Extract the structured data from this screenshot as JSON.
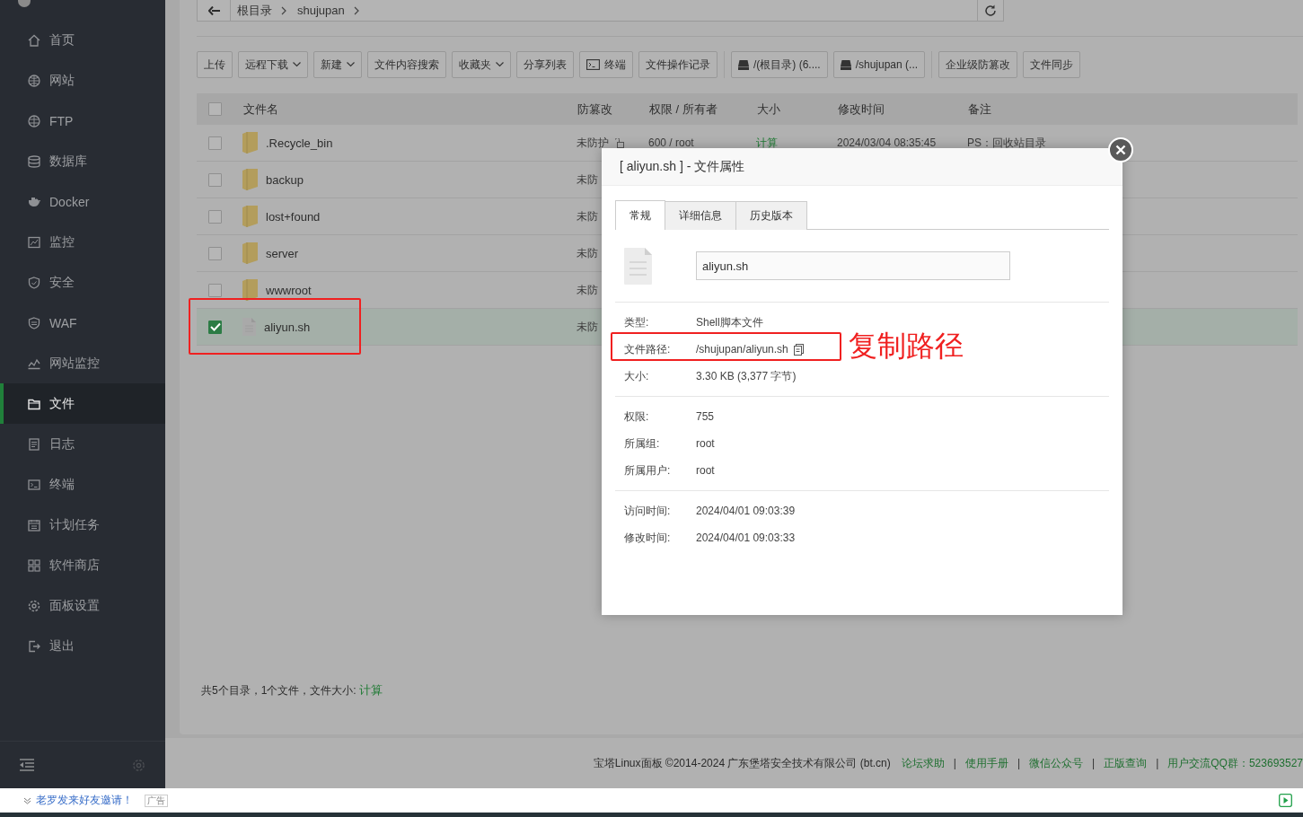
{
  "sidebar": {
    "items": [
      {
        "label": "首页",
        "selected": false
      },
      {
        "label": "网站",
        "selected": false
      },
      {
        "label": "FTP",
        "selected": false
      },
      {
        "label": "数据库",
        "selected": false
      },
      {
        "label": "Docker",
        "selected": false
      },
      {
        "label": "监控",
        "selected": false
      },
      {
        "label": "安全",
        "selected": false
      },
      {
        "label": "WAF",
        "selected": false
      },
      {
        "label": "网站监控",
        "selected": false
      },
      {
        "label": "文件",
        "selected": true
      },
      {
        "label": "日志",
        "selected": false
      },
      {
        "label": "终端",
        "selected": false
      },
      {
        "label": "计划任务",
        "selected": false
      },
      {
        "label": "软件商店",
        "selected": false
      },
      {
        "label": "面板设置",
        "selected": false
      },
      {
        "label": "退出",
        "selected": false
      }
    ]
  },
  "breadcrumb": {
    "crumbs": [
      "根目录",
      "shujupan"
    ]
  },
  "toolbar": [
    {
      "label": "上传",
      "kind": "button"
    },
    {
      "label": "远程下载",
      "kind": "dropdown"
    },
    {
      "label": "新建",
      "kind": "dropdown"
    },
    {
      "label": "文件内容搜索",
      "kind": "button"
    },
    {
      "label": "收藏夹",
      "kind": "dropdown"
    },
    {
      "label": "分享列表",
      "kind": "button"
    },
    {
      "label": "终端",
      "kind": "terminal"
    },
    {
      "label": "文件操作记录",
      "kind": "button"
    },
    {
      "label": "/(根目录) (6....",
      "kind": "disk"
    },
    {
      "label": "/shujupan (...",
      "kind": "disk"
    },
    {
      "label": "企业级防篡改",
      "kind": "button"
    },
    {
      "label": "文件同步",
      "kind": "button"
    }
  ],
  "table": {
    "all_checked": false,
    "columns": [
      "文件名",
      "防篡改",
      "权限 / 所有者",
      "大小",
      "修改时间",
      "备注"
    ],
    "rows": [
      {
        "name": ".Recycle_bin",
        "kind": "folder",
        "checked": false,
        "selected": false,
        "protection": "未防护",
        "permission": "600 / root",
        "size": "计算",
        "modified": "2024/03/04 08:35:45",
        "note": "PS：回收站目录"
      },
      {
        "name": "backup",
        "kind": "folder",
        "checked": false,
        "selected": false,
        "protection": "未防"
      },
      {
        "name": "lost+found",
        "kind": "folder",
        "checked": false,
        "selected": false,
        "protection": "未防"
      },
      {
        "name": "server",
        "kind": "folder",
        "checked": false,
        "selected": false,
        "protection": "未防"
      },
      {
        "name": "wwwroot",
        "kind": "folder",
        "checked": false,
        "selected": false,
        "protection": "未防"
      },
      {
        "name": "aliyun.sh",
        "kind": "file",
        "checked": true,
        "selected": true,
        "protection": "未防"
      }
    ]
  },
  "summary": {
    "text": "共5个目录，1个文件，文件大小: ",
    "link": "计算"
  },
  "footer": {
    "copyright": "宝塔Linux面板 ©2014-2024 广东堡塔安全技术有限公司 (bt.cn)",
    "links": [
      {
        "label": "论坛求助",
        "separator": "|"
      },
      {
        "label": "使用手册",
        "separator": "|"
      },
      {
        "label": "微信公众号",
        "separator": "|"
      },
      {
        "label": "正版查询",
        "separator": "|"
      },
      {
        "label": "用户交流QQ群：523693527"
      }
    ]
  },
  "dialog": {
    "title": "[ aliyun.sh ] - 文件属性",
    "tabs": [
      {
        "label": "常规",
        "selected": true
      },
      {
        "label": "详细信息",
        "selected": false
      },
      {
        "label": "历史版本",
        "selected": false
      }
    ],
    "filename": "aliyun.sh",
    "groups": [
      [
        {
          "label": "类型:",
          "value": "Shell脚本文件"
        },
        {
          "label": "文件路径:",
          "value": "/shujupan/aliyun.sh",
          "copy_button": true
        },
        {
          "label": "大小:",
          "value": "3.30 KB (3,377 字节)"
        }
      ],
      [
        {
          "label": "权限:",
          "value": "755"
        },
        {
          "label": "所属组:",
          "value": "root"
        },
        {
          "label": "所属用户:",
          "value": "root"
        }
      ],
      [
        {
          "label": "访问时间:",
          "value": "2024/04/01 09:03:39"
        },
        {
          "label": "修改时间:",
          "value": "2024/04/01 09:03:33"
        }
      ]
    ]
  },
  "annotation": {
    "label": "复制路径"
  },
  "notification": {
    "text": "老罗发来好友邀请！",
    "tag": "广告"
  }
}
